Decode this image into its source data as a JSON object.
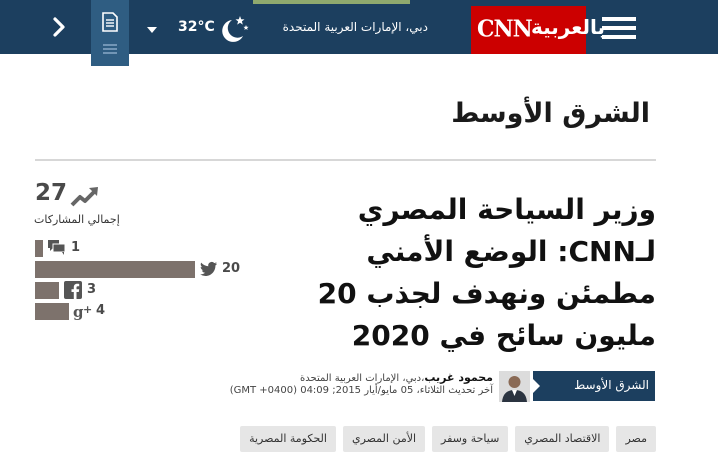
{
  "header": {
    "temperature": "32°C",
    "location": "دبي، الإمارات العربية المتحدة",
    "logo_latin": "CNN",
    "logo_arabic": "بالعربية",
    "icons": {
      "next": "chevron-right-icon",
      "article": "document-icon",
      "weather": "moon-stars-icon",
      "menu": "hamburger-menu-icon"
    },
    "colors": {
      "bar": "#1c3f5f",
      "logo": "#cc0000",
      "accent_strip": "#8fa96e"
    }
  },
  "section": {
    "title": "الشرق الأوسط"
  },
  "article": {
    "headline_lines": [
      "وزير السياحة المصري",
      "لـCNN: الوضع الأمني",
      "مطمئن ونهدف لجذب 20",
      "مليون سائح في 2020"
    ],
    "category_badge": "الشرق الأوسط",
    "author": "محمود غريب",
    "author_location": "،دبي، الإمارات العربية المتحدة",
    "updated": "آخر تحديث الثلاثاء، 05 مايو/أيار 2015; 04:09 (GMT +0400)"
  },
  "shares": {
    "total": "27",
    "label": "إجمالي المشاركات",
    "items": [
      {
        "network": "comments",
        "icon": "comment-bubbles-icon",
        "count": "1",
        "fraction": 0.05
      },
      {
        "network": "twitter",
        "icon": "twitter-bird-icon",
        "count": "20",
        "fraction": 1.0
      },
      {
        "network": "facebook",
        "icon": "facebook-icon",
        "count": "3",
        "fraction": 0.15
      },
      {
        "network": "google-plus",
        "icon": "google-plus-icon",
        "count": "4",
        "fraction": 0.2
      }
    ]
  },
  "tags": [
    "مصر",
    "الاقتصاد المصري",
    "سياحة وسفر",
    "الأمن المصري",
    "الحكومة المصرية"
  ]
}
